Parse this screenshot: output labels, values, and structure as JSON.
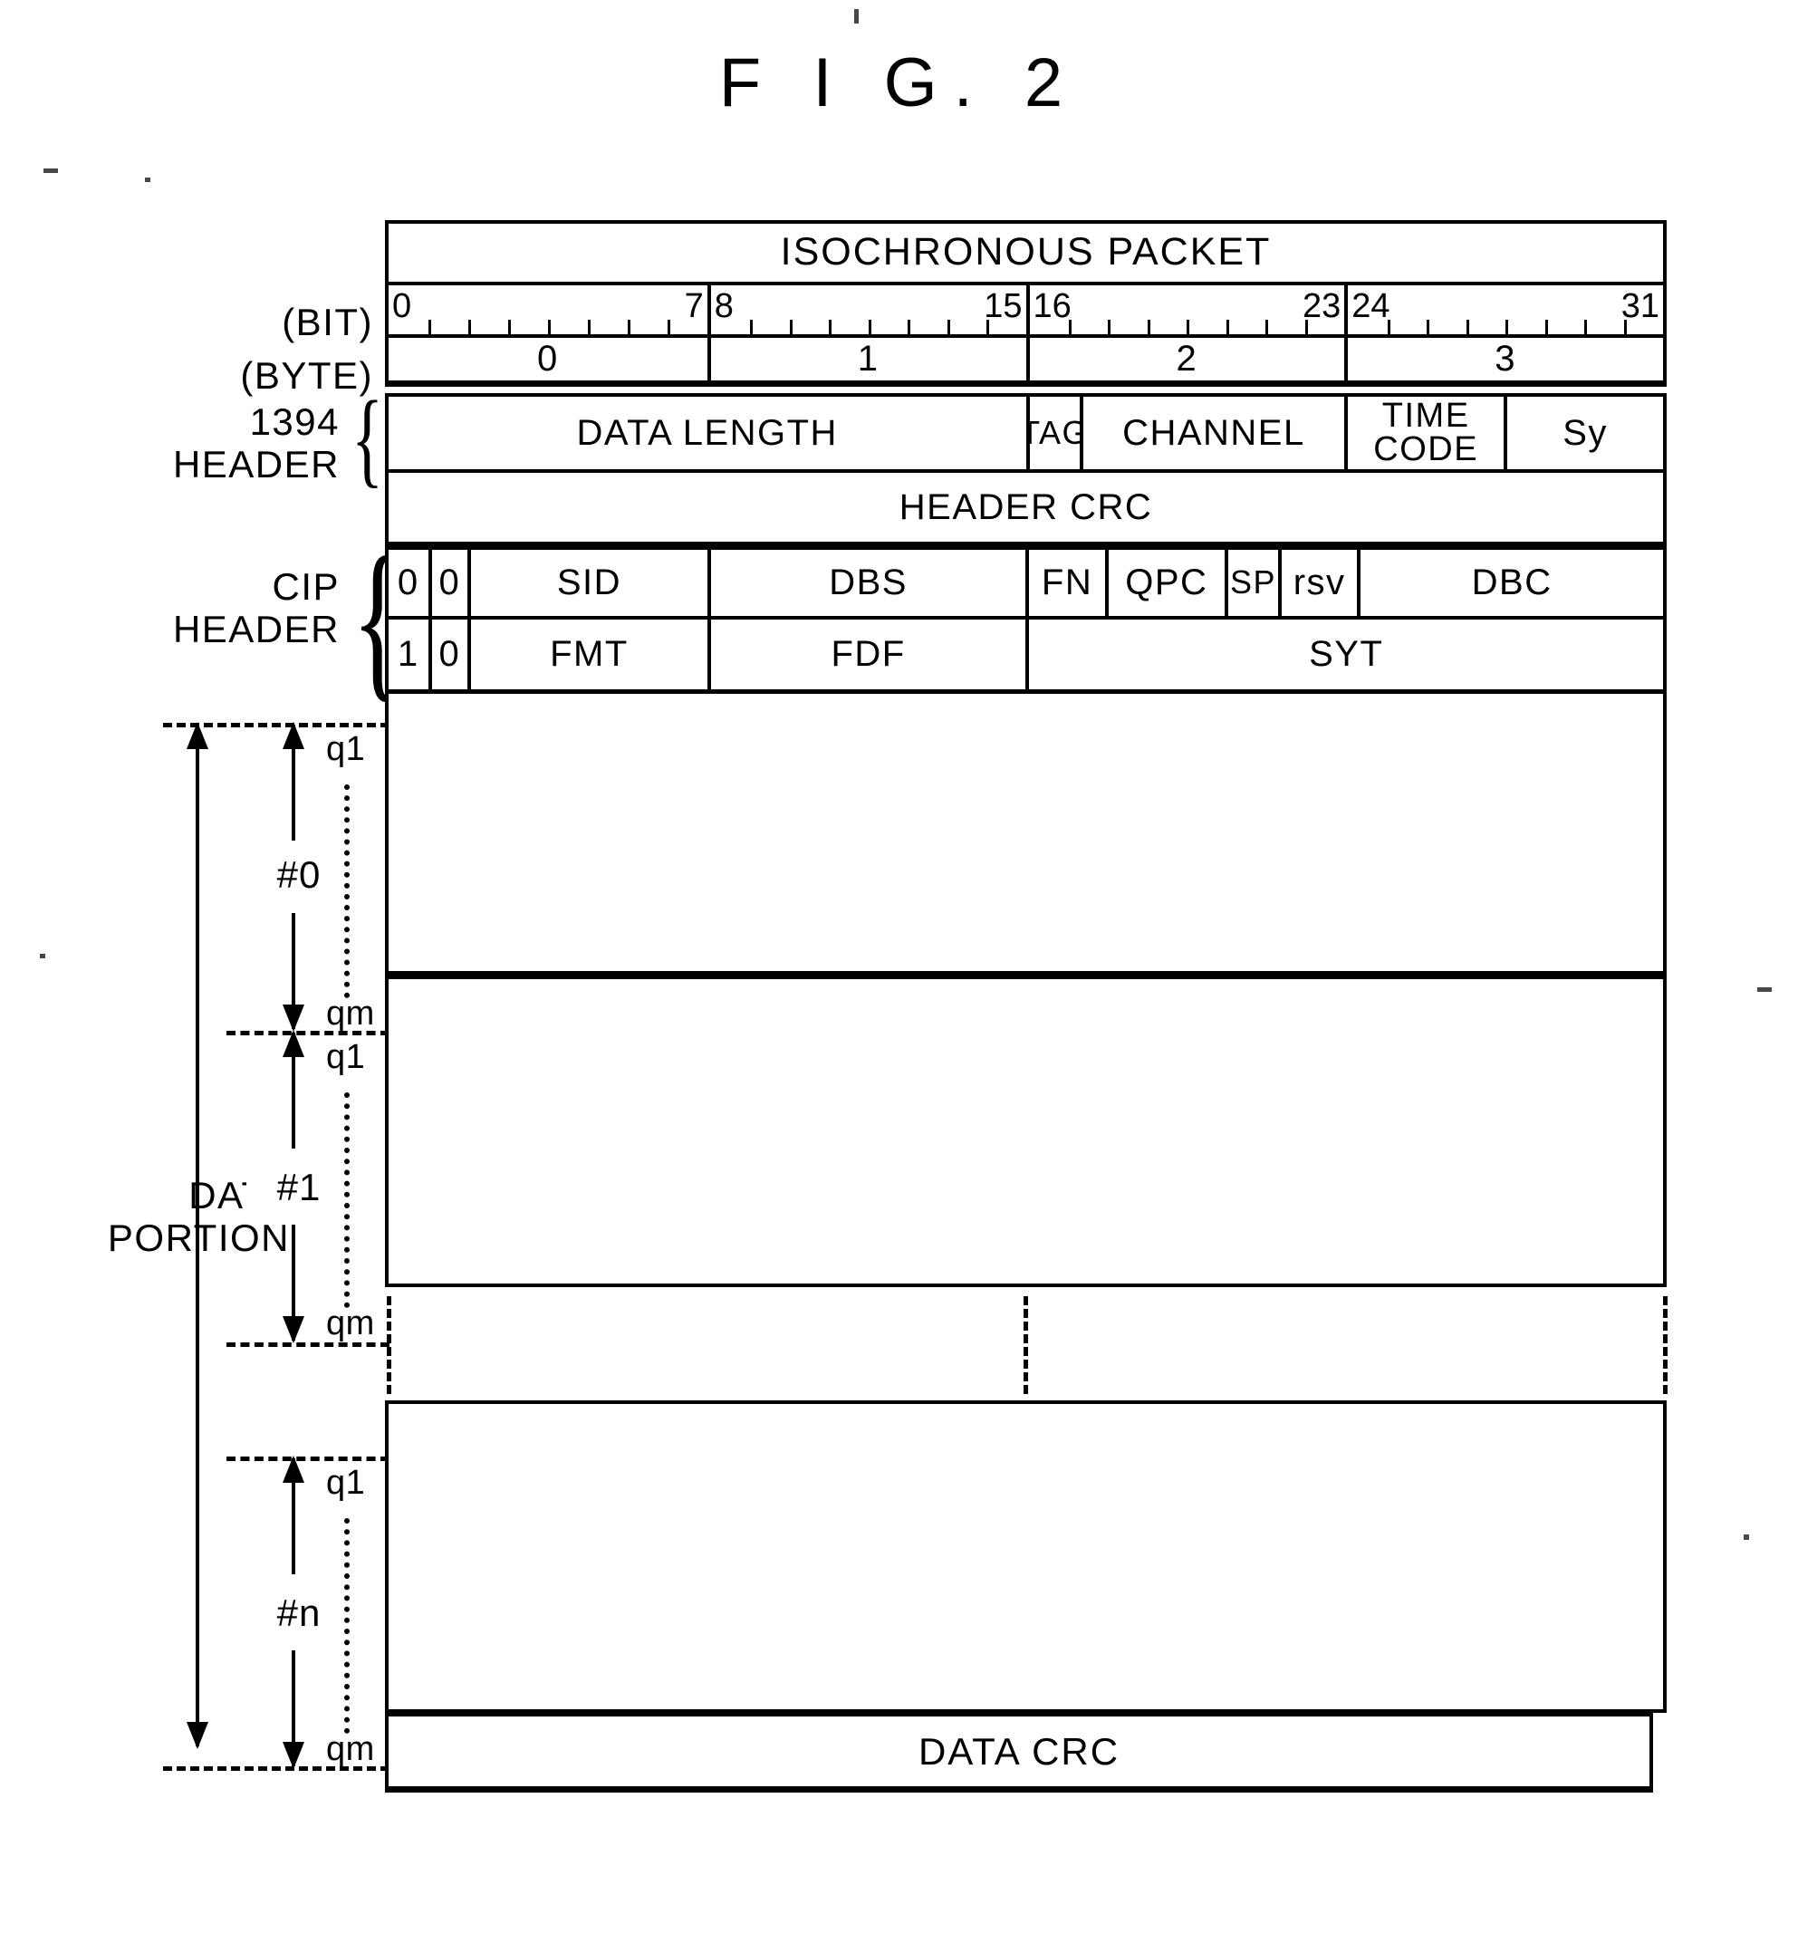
{
  "figure": {
    "title": "F I G. 2"
  },
  "diagram": {
    "packet_title": "ISOCHRONOUS PACKET",
    "rulers": {
      "bit_label": "(BIT)",
      "byte_label": "(BYTE)",
      "bit_ranges": [
        {
          "start": "0",
          "end": "7"
        },
        {
          "start": "8",
          "end": "15"
        },
        {
          "start": "16",
          "end": "23"
        },
        {
          "start": "24",
          "end": "31"
        }
      ],
      "bytes": [
        "0",
        "1",
        "2",
        "3"
      ]
    },
    "header_1394": {
      "label_line1": "1394",
      "label_line2": "HEADER",
      "row1": [
        {
          "text": "DATA LENGTH",
          "width": 50.0
        },
        {
          "text": "TAG",
          "width": 4.2
        },
        {
          "text": "CHANNEL",
          "width": 20.8
        },
        {
          "text": "TIME\nCODE",
          "width": 12.5
        },
        {
          "text": "Sy",
          "width": 12.5
        }
      ],
      "header_crc": "HEADER CRC"
    },
    "cip_header": {
      "label_line1": "CIP",
      "label_line2": "HEADER",
      "row1": [
        {
          "text": "0",
          "width": 3.1
        },
        {
          "text": "0",
          "width": 3.1
        },
        {
          "text": "SID",
          "width": 18.8
        },
        {
          "text": "DBS",
          "width": 25.0
        },
        {
          "text": "FN",
          "width": 6.2
        },
        {
          "text": "QPC",
          "width": 9.4
        },
        {
          "text": "SP",
          "width": 4.2
        },
        {
          "text": "rsv",
          "width": 6.2
        },
        {
          "text": "DBC",
          "width": 24.0
        }
      ],
      "row2": [
        {
          "text": "1",
          "width": 3.1
        },
        {
          "text": "0",
          "width": 3.1
        },
        {
          "text": "FMT",
          "width": 18.8
        },
        {
          "text": "FDF",
          "width": 25.0
        },
        {
          "text": "SYT",
          "width": 50.0
        }
      ]
    },
    "data_portion": {
      "label_line1": "DATA",
      "label_line2": "PORTION",
      "blocks": [
        {
          "name": "#0",
          "q_first": "q1",
          "q_last": "qm"
        },
        {
          "name": "#1",
          "q_first": "q1",
          "q_last": "qm"
        },
        {
          "name": "#n",
          "q_first": "q1",
          "q_last": "qm"
        }
      ],
      "data_crc": "DATA CRC"
    }
  }
}
